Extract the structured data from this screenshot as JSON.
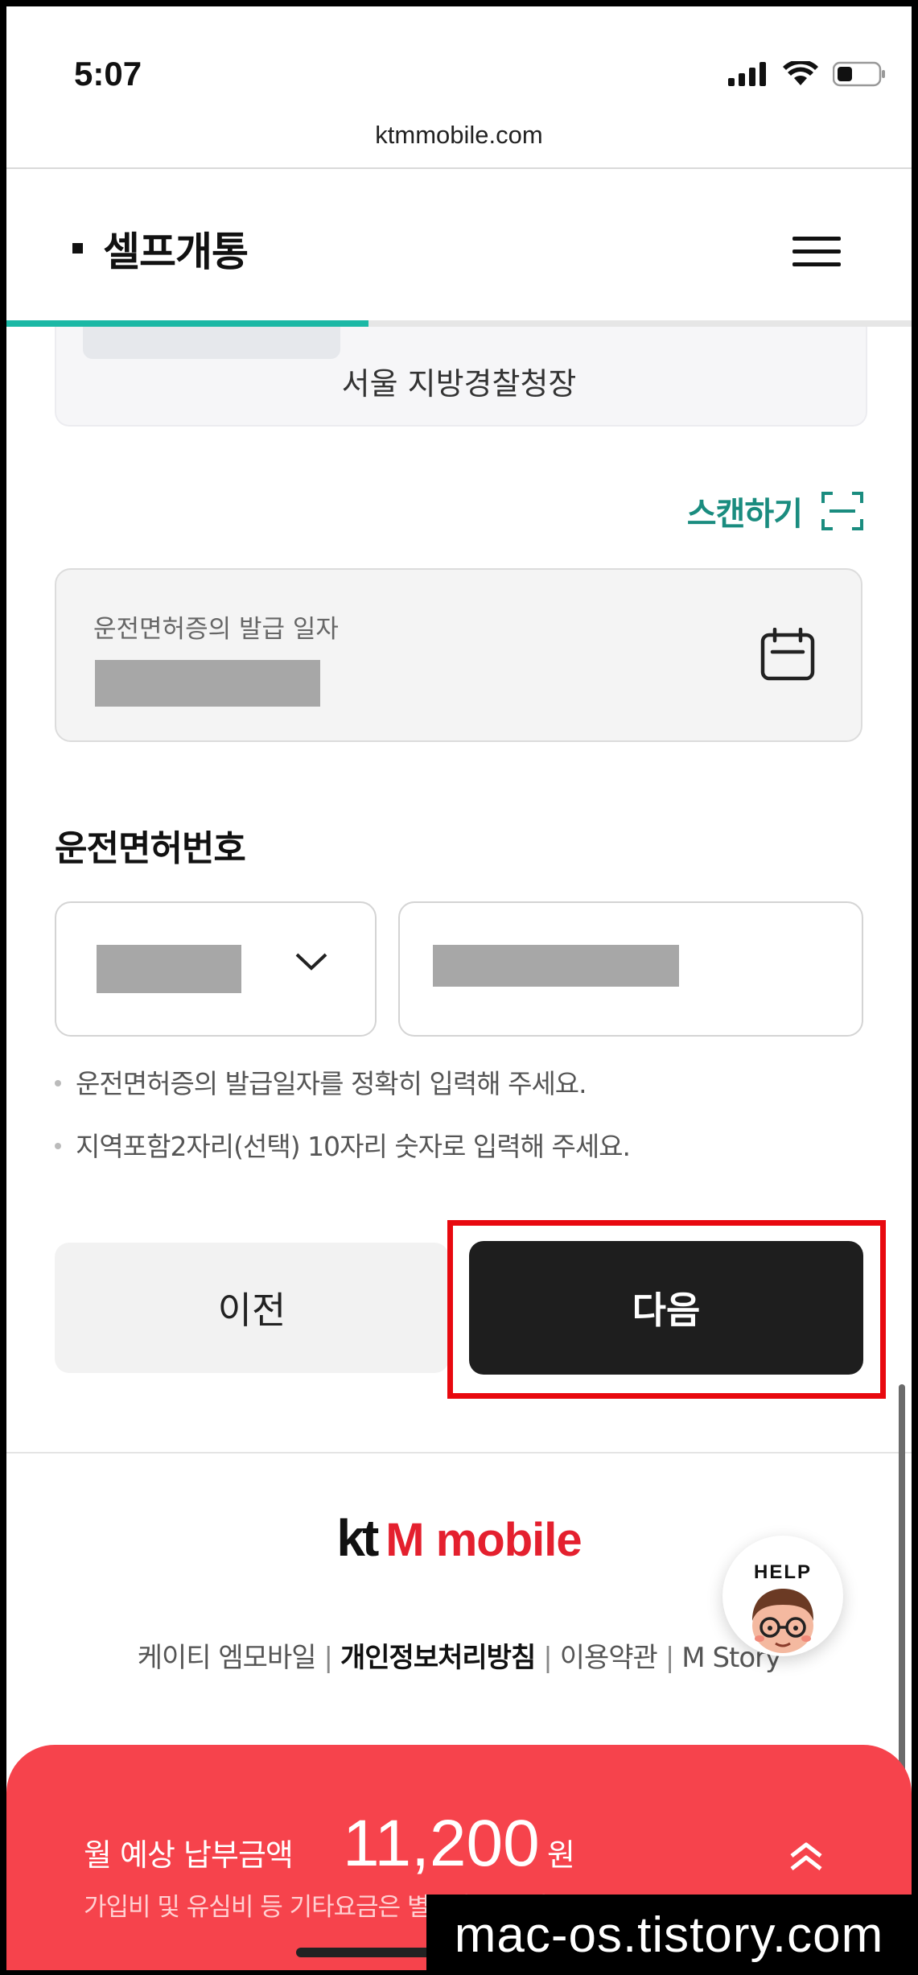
{
  "status_bar": {
    "time": "5:07",
    "url": "ktmmobile.com"
  },
  "header": {
    "title": "셀프개통",
    "menu_icon": "hamburger-icon",
    "progress_fraction": 0.4
  },
  "id_card": {
    "issuer": "서울 지방경찰청장"
  },
  "scan": {
    "label": "스캔하기",
    "icon": "scan-frame-icon",
    "accent_color": "#1a8c7f"
  },
  "issue_date": {
    "label": "운전면허증의 발급 일자",
    "icon": "calendar-icon"
  },
  "license": {
    "title": "운전면허번호",
    "region_dropdown_icon": "chevron-down-icon"
  },
  "hints": [
    "운전면허증의 발급일자를 정확히 입력해 주세요.",
    "지역포함2자리(선택) 10자리 숫자로 입력해 주세요."
  ],
  "buttons": {
    "prev": "이전",
    "next": "다음"
  },
  "footer": {
    "logo_kt": "kt",
    "logo_m": "M mobile",
    "links": [
      "케이티 엠모바일",
      "개인정보처리방침",
      "이용약관",
      "M Story"
    ],
    "help": "HELP"
  },
  "bottom_sheet": {
    "label": "월 예상 납부금액",
    "amount": "11,200",
    "unit": "원",
    "note": "가입비 및 유심비 등 기타요금은 별도 청구됩니다.",
    "color": "#f6434c"
  },
  "watermark": "mac-os.tistory.com"
}
